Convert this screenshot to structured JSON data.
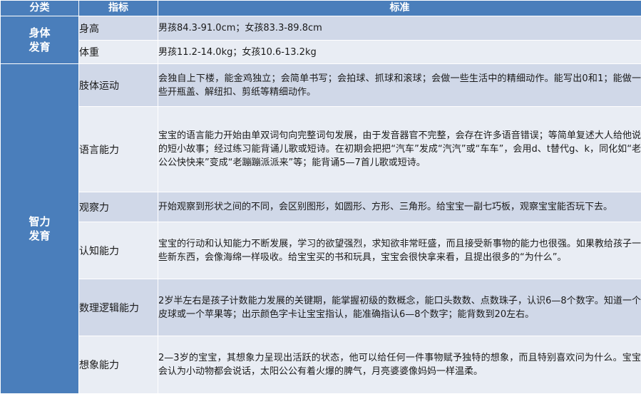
{
  "header": {
    "col_category": "分类",
    "col_indicator": "指标",
    "col_standard": "标准"
  },
  "groups": [
    {
      "category": "身体发育",
      "rows": [
        {
          "indicator": "身高",
          "standard": "男孩84.3-91.0cm；女孩83.3-89.8cm"
        },
        {
          "indicator": "体重",
          "standard": "男孩11.2-14.0kg；女孩10.6-13.2kg"
        }
      ]
    },
    {
      "category": "智力发育",
      "rows": [
        {
          "indicator": "肢体运动",
          "standard": "会独自上下楼，能金鸡独立；会简单书写；会拍球、抓球和滚球；会做一些生活中的精细动作。能写出0和1；能做一些开瓶盖、解纽扣、剪纸等精细动作。"
        },
        {
          "indicator": "语言能力",
          "standard": "宝宝的语言能力开始由单双词句向完整词句发展，由于发音器官不完整，会存在许多语音错误；等简单复述大人给他说的短小故事；经过练习能背诵儿歌或短诗。在初期会把把“汽车”发成“汽汽”或“车车”，会用d、t替代g、k，同化如“老公公快快来”变成“老蹦蹦派派来”等；能背诵5—7首儿歌或短诗。"
        },
        {
          "indicator": "观察力",
          "standard": "开始观察到形状之间的不同，会区别图形，如圆形、方形、三角形。给宝宝一副七巧板，观察宝宝能否玩下去。"
        },
        {
          "indicator": "认知能力",
          "standard": "宝宝的行动和认知能力不断发展，学习的欲望强烈，求知欲非常旺盛，而且接受新事物的能力也很强。如果教给孩子一些新东西，会像海绵一样吸收。给宝宝买的书和玩具，宝宝会很快拿来看，且提出很多的“为什么”。"
        },
        {
          "indicator": "数理逻辑能力",
          "standard": "2岁半左右是孩子计数能力发展的关键期，能掌握初级的数概念，能口头数数、点数珠子，认识6—8个数字。知道一个皮球或一个苹果等；出示颜色字卡让宝宝指认，能准确指认6—8个数字；能背数到20左右。"
        },
        {
          "indicator": "想象能力",
          "standard": "2—3岁的宝宝，其想象力呈现出活跃的状态，他可以给任何一件事物赋予独特的想象，而且特别喜欢问为什么。宝宝会认为小动物都会说话，太阳公公有着火爆的脾气，月亮婆婆像妈妈一样温柔。"
        }
      ]
    }
  ],
  "colors": {
    "header_bg": "#4a7ebb",
    "row_dark": "#d0d8e8",
    "row_light": "#e9edf4"
  }
}
